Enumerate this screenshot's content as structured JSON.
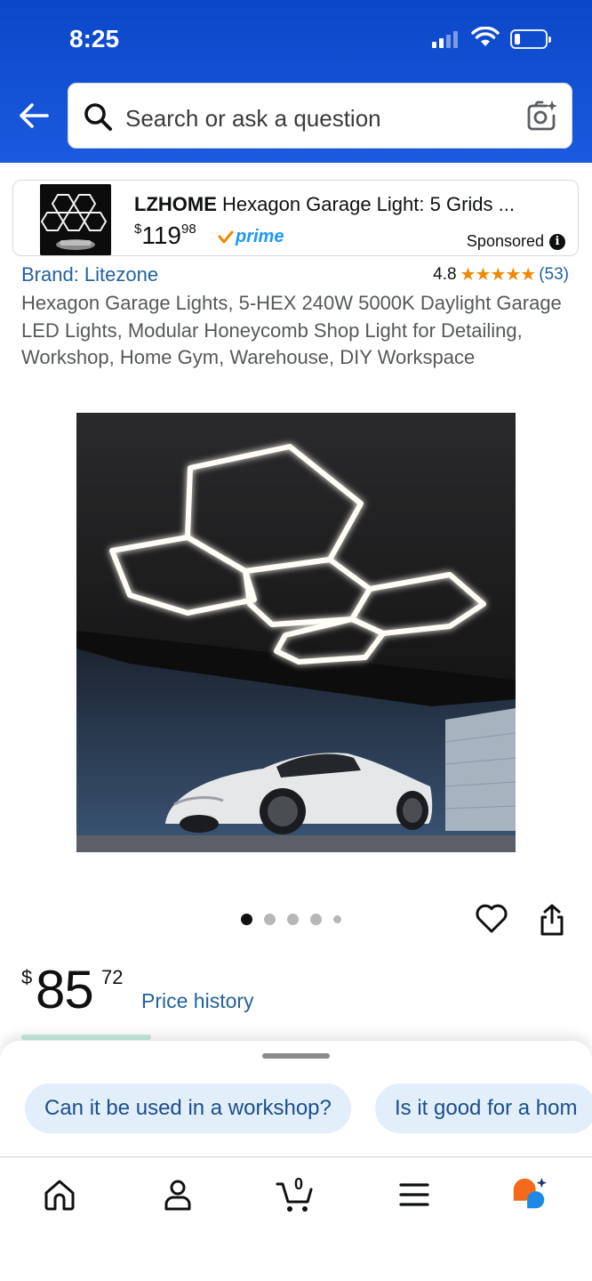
{
  "status_bar": {
    "time": "8:25"
  },
  "header": {
    "back_icon": "arrow-left-icon",
    "search_placeholder": "Search or ask a question",
    "camera_icon": "camera-sparkle-icon"
  },
  "sponsored": {
    "brand": "LZHOME",
    "title_rest": " Hexagon Garage Light: 5 Grids ...",
    "price_currency": "$",
    "price_whole": "119",
    "price_fraction": "98",
    "prime_label": "prime",
    "sponsored_label": "Sponsored",
    "info_icon": "info-icon"
  },
  "product": {
    "brand": "Brand: Litezone",
    "rating": "4.8",
    "stars": "★★★★★",
    "rating_count": "(53)",
    "title": "Hexagon Garage Lights, 5-HEX 240W 5000K Daylight Garage LED Lights, Modular Honeycomb Shop Light for Detailing, Workshop, Home Gym, Warehouse, DIY Workspace",
    "image_count": 5,
    "active_image": 1
  },
  "price": {
    "currency": "$",
    "whole": "85",
    "fraction": "72",
    "history_link": "Price history"
  },
  "suggestions": [
    "Can it be used in a workshop?",
    "Is it good for a hom"
  ],
  "nav": {
    "items": [
      "home-icon",
      "account-icon",
      "cart-icon",
      "menu-icon",
      "rufus-ai-icon"
    ],
    "cart_count": "0"
  },
  "colors": {
    "header_blue": "#1a55d6",
    "link_blue": "#2162a1",
    "star_orange": "#f08804",
    "prime_blue": "#1a98ff",
    "chip_bg": "#e3eefb"
  }
}
